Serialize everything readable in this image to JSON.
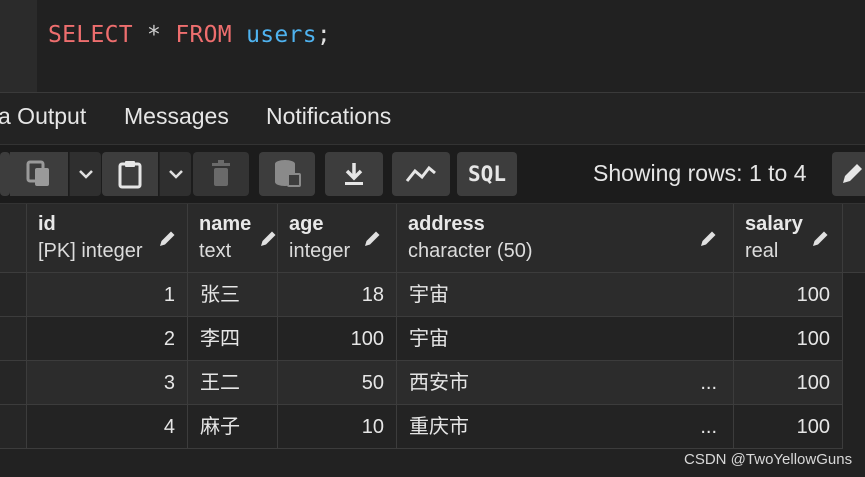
{
  "editor": {
    "keyword_select": "SELECT",
    "star": "*",
    "keyword_from": "FROM",
    "table": "users",
    "semicolon": ";"
  },
  "tabs": [
    {
      "label": "a Output"
    },
    {
      "label": "Messages"
    },
    {
      "label": "Notifications"
    }
  ],
  "toolbar": {
    "rows_info": "Showing rows: 1 to 4",
    "sql_label": "SQL"
  },
  "columns": [
    {
      "name": "id",
      "type": "[PK] integer"
    },
    {
      "name": "name",
      "type": "text"
    },
    {
      "name": "age",
      "type": "integer"
    },
    {
      "name": "address",
      "type": "character (50)"
    },
    {
      "name": "salary",
      "type": "real"
    }
  ],
  "rows": [
    {
      "id": "1",
      "name": "张三",
      "age": "18",
      "address": "宇宙",
      "address_more": "",
      "salary": "100"
    },
    {
      "id": "2",
      "name": "李四",
      "age": "100",
      "address": "宇宙",
      "address_more": "",
      "salary": "100"
    },
    {
      "id": "3",
      "name": "王二",
      "age": "50",
      "address": "西安市",
      "address_more": "...",
      "salary": "100"
    },
    {
      "id": "4",
      "name": "麻子",
      "age": "10",
      "address": "重庆市",
      "address_more": "...",
      "salary": "100"
    }
  ],
  "watermark": "CSDN @TwoYellowGuns"
}
